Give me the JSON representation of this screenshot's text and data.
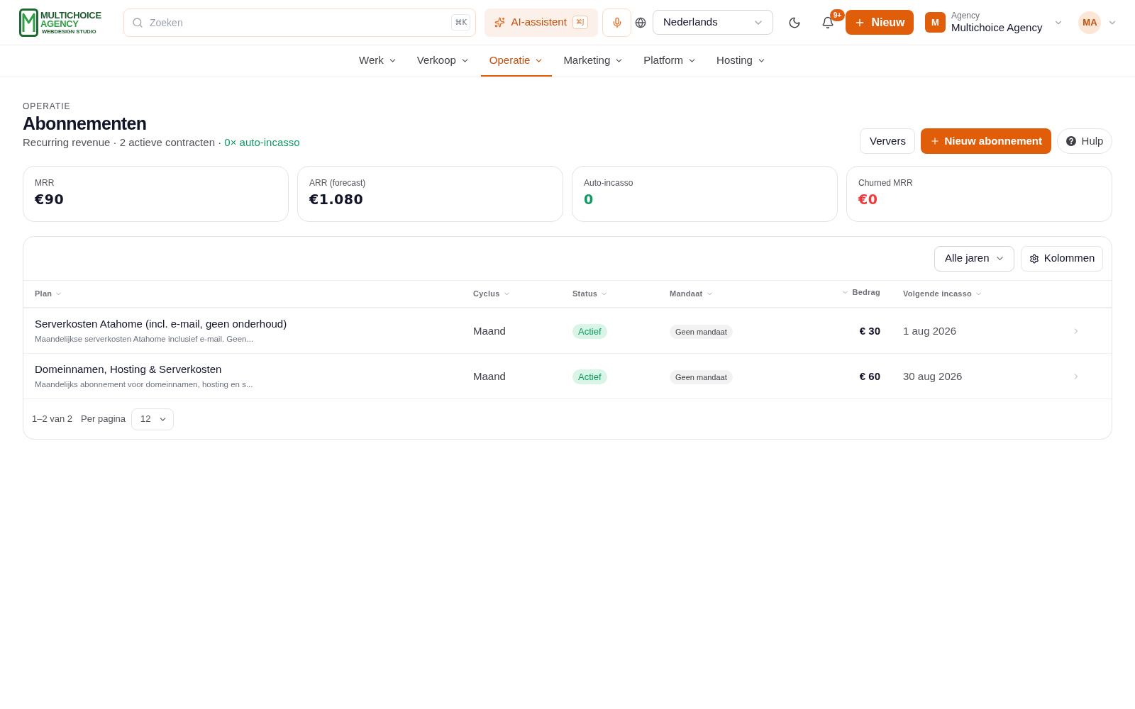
{
  "header": {
    "logo": {
      "line_1": "MULTICHOICE",
      "line_2": "AGENCY",
      "tagline": "WEBDESIGN STUDIO"
    },
    "search": {
      "placeholder": "Zoeken",
      "shortcut": "⌘K"
    },
    "ai_assistant": {
      "label": "AI-assistent",
      "shortcut": "⌘J"
    },
    "language": {
      "value": "Nederlands"
    },
    "notifications": {
      "badge": "9+"
    },
    "new_button": {
      "label": "Nieuw"
    },
    "workspace": {
      "initial": "M",
      "caption": "Agency",
      "name": "Multichoice Agency"
    },
    "user": {
      "initials": "MA"
    }
  },
  "nav": [
    {
      "label": "Werk",
      "selected": false
    },
    {
      "label": "Verkoop",
      "selected": false
    },
    {
      "label": "Operatie",
      "selected": true
    },
    {
      "label": "Marketing",
      "selected": false
    },
    {
      "label": "Platform",
      "selected": false
    },
    {
      "label": "Hosting",
      "selected": false
    }
  ],
  "page": {
    "eyebrow": "OPERATIE",
    "title": "Abonnementen",
    "subtitle": [
      {
        "text": "Recurring revenue · 2 actieve contracten ·",
        "kind": "plain"
      },
      {
        "text": "0× auto-incasso",
        "kind": "highlight"
      }
    ],
    "actions": [
      {
        "label": "Ververs",
        "kind": "outline"
      },
      {
        "label": "Nieuw abonnement",
        "kind": "primary"
      },
      {
        "label": "Hulp",
        "kind": "help"
      }
    ]
  },
  "stats": [
    {
      "label": "MRR",
      "value": "€90",
      "kind": "neutral"
    },
    {
      "label": "ARR (forecast)",
      "value": "€1.080",
      "kind": "neutral"
    },
    {
      "label": "Auto-incasso",
      "value": "0",
      "kind": "positive"
    },
    {
      "label": "Churned MRR",
      "value": "€0",
      "kind": "negative"
    }
  ],
  "table": {
    "year_filter": "Alle jaren",
    "columns_button": "Kolommen",
    "columns": [
      {
        "label": "Plan",
        "kind": "text"
      },
      {
        "label": "Cyclus",
        "kind": "text"
      },
      {
        "label": "Status",
        "kind": "text"
      },
      {
        "label": "Mandaat",
        "kind": "text"
      },
      {
        "label": "Bedrag",
        "kind": "amount"
      },
      {
        "label": "Volgende incasso",
        "kind": "text"
      }
    ],
    "rows": [
      {
        "plan": "Serverkosten Atahome (incl. e-mail, geen onderhoud)",
        "description": "Maandelijkse serverkosten Atahome inclusief e-mail. Geen...",
        "cycle": "Maand",
        "status": {
          "label": "Actief",
          "kind": "active"
        },
        "mandate": "Geen mandaat",
        "amount": "€ 30",
        "next_collection": "1 aug 2026"
      },
      {
        "plan": "Domeinnamen, Hosting & Serverkosten",
        "description": "Maandelijks abonnement voor domeinnamen, hosting en s...",
        "cycle": "Maand",
        "status": {
          "label": "Actief",
          "kind": "active"
        },
        "mandate": "Geen mandaat",
        "amount": "€ 60",
        "next_collection": "30 aug 2026"
      }
    ],
    "pagination": {
      "range": "1–2 van 2",
      "per_page_label": "Per pagina",
      "per_page": "12"
    }
  }
}
